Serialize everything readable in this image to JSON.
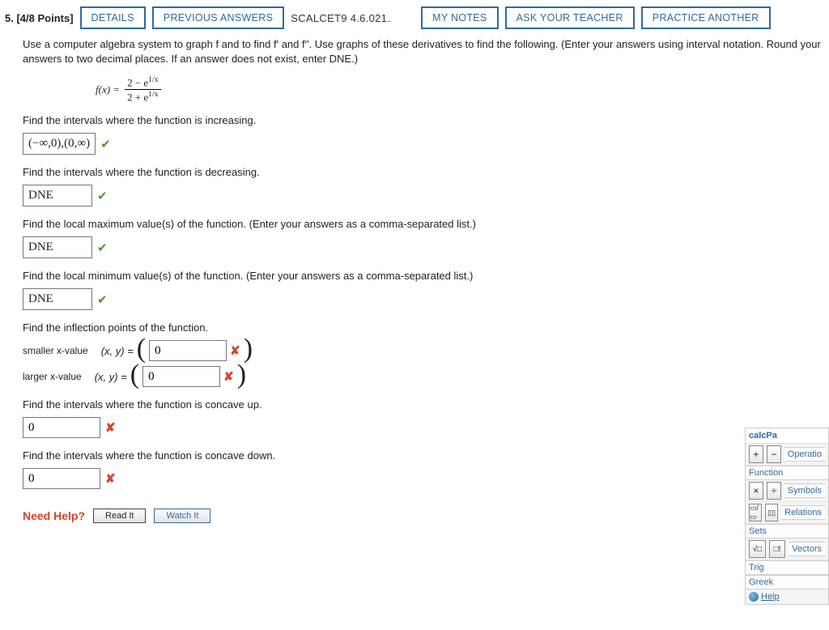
{
  "header": {
    "qnum": "5.",
    "points": "[4/8 Points]",
    "details_label": "DETAILS",
    "prev_label": "PREVIOUS ANSWERS",
    "ref": "SCALCET9 4.6.021.",
    "mynotes_label": "MY NOTES",
    "ask_label": "ASK YOUR TEACHER",
    "practice_label": "PRACTICE ANOTHER"
  },
  "instr": "Use a computer algebra system to graph f and to find f' and f''. Use graphs of these derivatives to find the following. (Enter your answers using interval notation. Round your answers to two decimal places. If an answer does not exist, enter DNE.)",
  "formula": {
    "lhs": "f(x) =",
    "num": "2 − e",
    "num_exp": "1/x",
    "den": "2 + e",
    "den_exp": "1/x"
  },
  "q": {
    "incr": "Find the intervals where the function is increasing.",
    "decr": "Find the intervals where the function is decreasing.",
    "locmax": "Find the local maximum value(s) of the function. (Enter your answers as a comma-separated list.)",
    "locmin": "Find the local minimum value(s) of the function. (Enter your answers as a comma-separated list.)",
    "infl": "Find the inflection points of the function.",
    "smaller": "smaller x-value",
    "larger": "larger x-value",
    "xy_eq": "(x, y)  =",
    "conc_up": "Find the intervals where the function is concave up.",
    "conc_down": "Find the intervals where the function is concave down."
  },
  "ans": {
    "incr": "(−∞,0),(0,∞)",
    "decr": "DNE",
    "locmax": "DNE",
    "locmin": "DNE",
    "infl1": "0",
    "infl2": "0",
    "concup": "0",
    "concdown": "0"
  },
  "needhelp": {
    "label": "Need Help?",
    "read": "Read It",
    "watch": "Watch It"
  },
  "calcpad": {
    "title": "calcPa",
    "tabs": [
      "Operatio",
      "Function",
      "Symbols",
      "Relations",
      "Sets",
      "Vectors",
      "Trig",
      "Greek"
    ],
    "help": "Help",
    "keys": {
      "plus": "+",
      "minus": "−",
      "mult": "×",
      "div": "÷",
      "sqrt": "√□",
      "fact": "□!",
      "frac": "▭/▭",
      "boxexp": "▯▯"
    }
  }
}
